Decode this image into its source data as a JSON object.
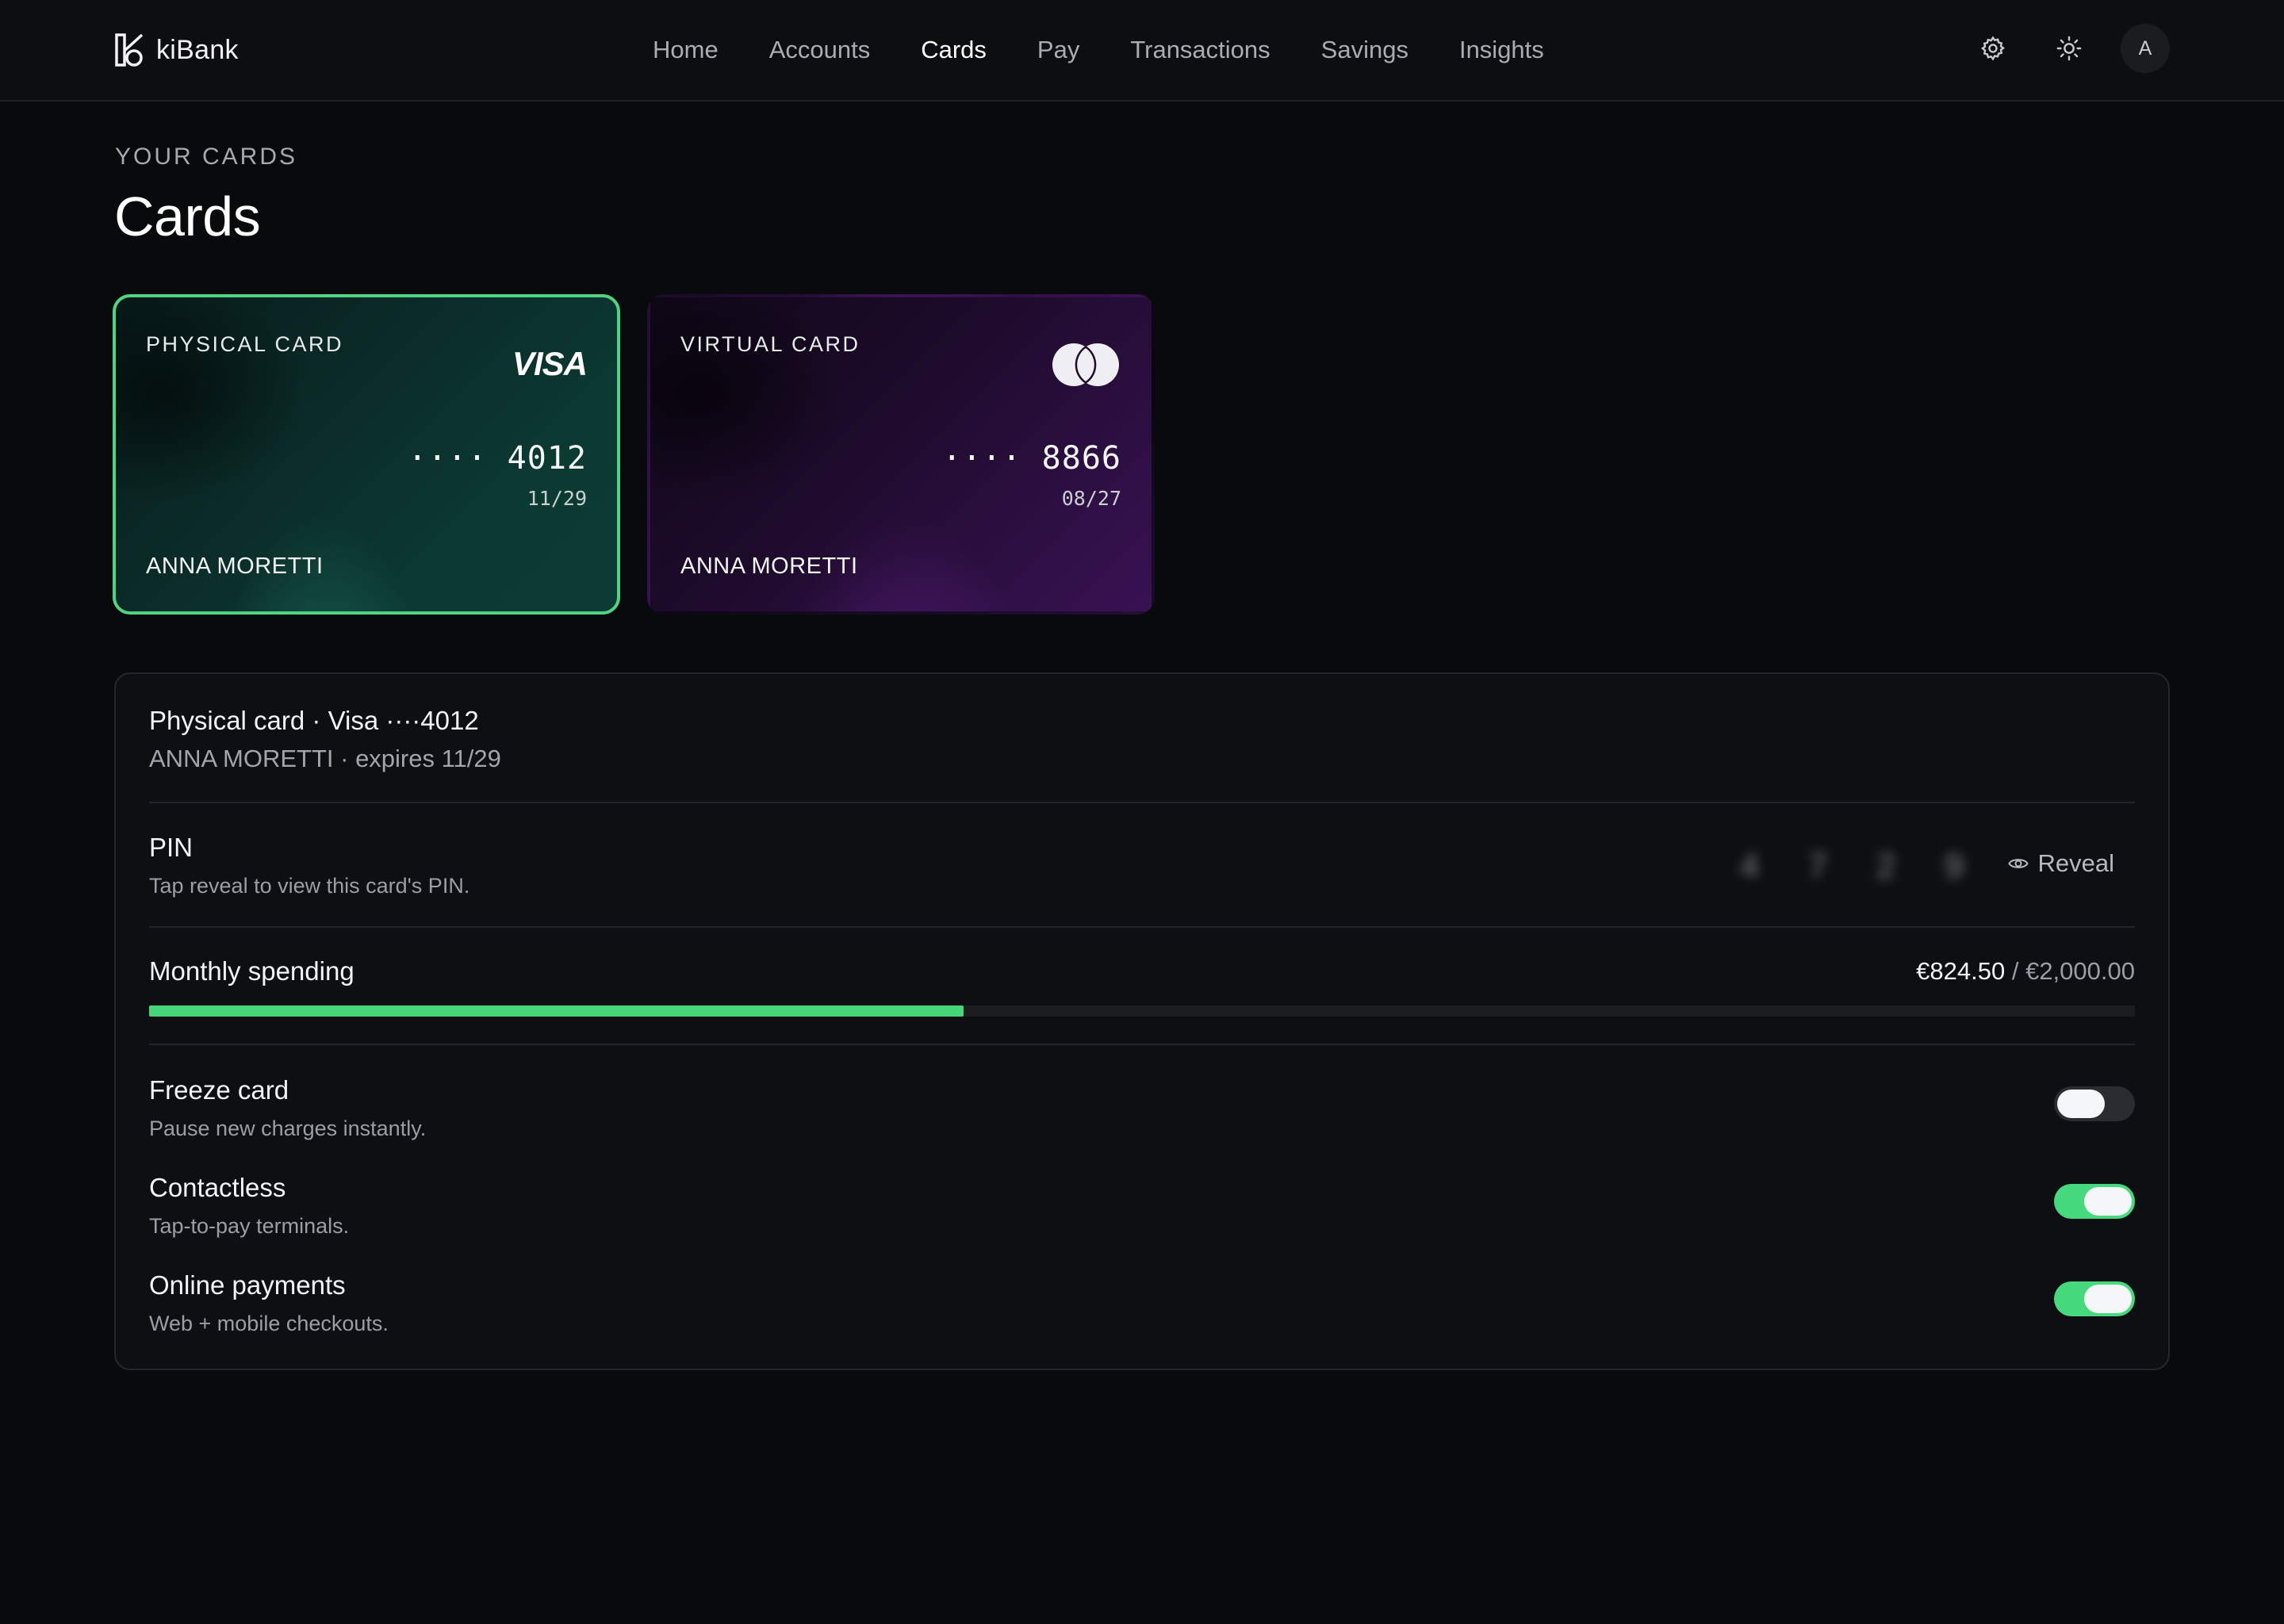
{
  "app": {
    "name": "kiBank"
  },
  "nav": [
    {
      "label": "Home",
      "active": false
    },
    {
      "label": "Accounts",
      "active": false
    },
    {
      "label": "Cards",
      "active": true
    },
    {
      "label": "Pay",
      "active": false
    },
    {
      "label": "Transactions",
      "active": false
    },
    {
      "label": "Savings",
      "active": false
    },
    {
      "label": "Insights",
      "active": false
    }
  ],
  "header_actions": {
    "settings_icon": "gear-icon",
    "theme_icon": "sun-icon",
    "avatar_initial": "A"
  },
  "page": {
    "eyebrow": "YOUR CARDS",
    "title": "Cards"
  },
  "cards": [
    {
      "type": "PHYSICAL CARD",
      "brand": "VISA",
      "number": "···· 4012",
      "expiry": "11/29",
      "holder": "ANNA MORETTI",
      "selected": true,
      "accent": "#0b3a33"
    },
    {
      "type": "VIRTUAL CARD",
      "brand": "mastercard-logo",
      "number": "···· 8866",
      "expiry": "08/27",
      "holder": "ANNA MORETTI",
      "selected": false,
      "accent": "#381152"
    }
  ],
  "details": {
    "title": "Physical card · Visa ····4012",
    "subtitle": "ANNA MORETTI · expires 11/29",
    "pin": {
      "label": "PIN",
      "hint": "Tap reveal to view this card's PIN.",
      "digits": [
        "4",
        "7",
        "2",
        "9"
      ],
      "masked": true,
      "reveal_label": "Reveal"
    },
    "spending": {
      "label": "Monthly spending",
      "current": "€824.50",
      "separator": "/",
      "limit": "€2,000.00",
      "fraction": 0.41
    },
    "toggles": [
      {
        "label": "Freeze card",
        "hint": "Pause new charges instantly.",
        "on": false
      },
      {
        "label": "Contactless",
        "hint": "Tap-to-pay terminals.",
        "on": true
      },
      {
        "label": "Online payments",
        "hint": "Web + mobile checkouts.",
        "on": true
      }
    ]
  },
  "colors": {
    "accent_green": "#45d67a",
    "selected_border": "#4fd483",
    "background": "#090a0c"
  }
}
